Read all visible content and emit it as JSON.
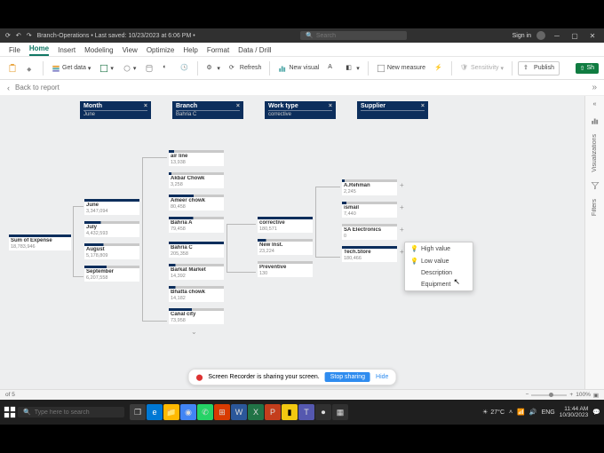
{
  "titlebar": {
    "file_info": "Branch-Operations • Last saved: 10/23/2023 at 6:06 PM •",
    "search_placeholder": "Search",
    "signin": "Sign in"
  },
  "tabs": {
    "items": [
      "File",
      "Home",
      "Insert",
      "Modeling",
      "View",
      "Optimize",
      "Help",
      "Format",
      "Data / Drill"
    ],
    "active": 1
  },
  "ribbon": {
    "getdata": "Get data",
    "refresh": "Refresh",
    "newvisual": "New visual",
    "newmeasure": "New measure",
    "sensitivity": "Sensitivity",
    "publish": "Publish",
    "share": "Sh"
  },
  "backrow": {
    "label": "Back to report"
  },
  "panes": {
    "viz": "Visualizations",
    "filters": "Filters"
  },
  "slicers": [
    {
      "title": "Month",
      "value": "June"
    },
    {
      "title": "Branch",
      "value": "Bahria C"
    },
    {
      "title": "Work type",
      "value": "corrective"
    },
    {
      "title": "Supplier",
      "value": ""
    }
  ],
  "tree": {
    "root": {
      "name": "Sum of Expense",
      "val": "18,783,946"
    },
    "months": [
      {
        "name": "June",
        "val": "3,347,094"
      },
      {
        "name": "July",
        "val": "4,432,593"
      },
      {
        "name": "August",
        "val": "5,178,809"
      },
      {
        "name": "September",
        "val": "6,207,558"
      }
    ],
    "branches": [
      {
        "name": "air line",
        "val": "13,938"
      },
      {
        "name": "Akbar Chowk",
        "val": "3,258"
      },
      {
        "name": "Ameer chowk",
        "val": "80,458"
      },
      {
        "name": "Bahria A",
        "val": "79,458"
      },
      {
        "name": "Bahria C",
        "val": "205,358"
      },
      {
        "name": "Barkat Market",
        "val": "14,392"
      },
      {
        "name": "Bhatta chowk",
        "val": "14,182"
      },
      {
        "name": "Canal city",
        "val": "73,958"
      }
    ],
    "worktypes": [
      {
        "name": "corrective",
        "val": "180,571"
      },
      {
        "name": "New Inst.",
        "val": "23,224"
      },
      {
        "name": "Preventive",
        "val": "130"
      }
    ],
    "suppliers": [
      {
        "name": "A.Rehman",
        "val": "2,245"
      },
      {
        "name": "ismail",
        "val": "7,440"
      },
      {
        "name": "SA Electronics",
        "val": "0"
      },
      {
        "name": "Tech.Store",
        "val": "180,466"
      }
    ]
  },
  "ctxmenu": {
    "items": [
      "High value",
      "Low value",
      "Description",
      "Equipment"
    ]
  },
  "sharebar": {
    "msg": "Screen Recorder is sharing your screen.",
    "stop": "Stop sharing",
    "hide": "Hide"
  },
  "statusbar": {
    "page": "of 5",
    "zoom": "100%"
  },
  "taskbar": {
    "search_placeholder": "Type here to search",
    "weather_temp": "27°C",
    "time": "11:44 AM",
    "date": "10/30/2023"
  },
  "colors": {
    "navy": "#0c2e5c",
    "teal": "#117865",
    "blue_btn": "#2f8cef"
  }
}
